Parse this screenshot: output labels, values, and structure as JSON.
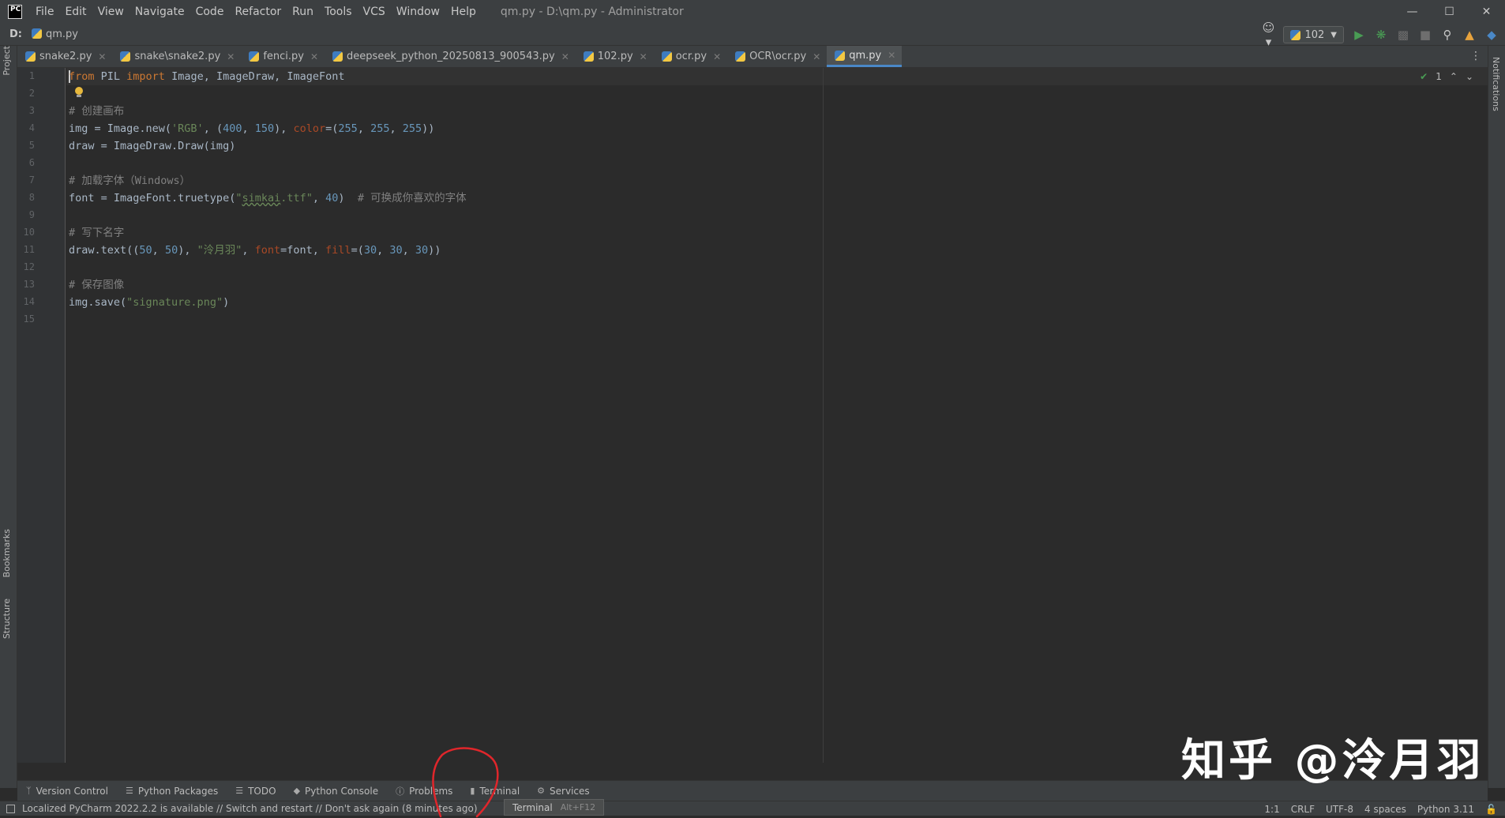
{
  "titlebar": {
    "logo": "PC",
    "menu": [
      "File",
      "Edit",
      "View",
      "Navigate",
      "Code",
      "Refactor",
      "Run",
      "Tools",
      "VCS",
      "Window",
      "Help"
    ],
    "window_title": "qm.py - D:\\qm.py - Administrator"
  },
  "navbar": {
    "drive": "D:",
    "file": "qm.py",
    "run_config": "102"
  },
  "tabs": [
    {
      "label": "snake2.py"
    },
    {
      "label": "snake\\snake2.py"
    },
    {
      "label": "fenci.py"
    },
    {
      "label": "deepseek_python_20250813_900543.py"
    },
    {
      "label": "102.py"
    },
    {
      "label": "ocr.py"
    },
    {
      "label": "OCR\\ocr.py"
    },
    {
      "label": "qm.py",
      "active": true
    }
  ],
  "left_tools": [
    "Project",
    "Bookmarks",
    "Structure"
  ],
  "right_tools": [
    "Notifications"
  ],
  "editor": {
    "line_numbers": [
      "1",
      "2",
      "3",
      "4",
      "5",
      "6",
      "7",
      "8",
      "9",
      "10",
      "11",
      "12",
      "13",
      "14",
      "15"
    ],
    "inspection_count": "1",
    "lines": {
      "l1": {
        "kw1": "from",
        "t1": " PIL ",
        "kw2": "import",
        "t2": " Image, ImageDraw, ImageFont"
      },
      "l3": "# 创建画布",
      "l4": {
        "t1": "img = Image.new(",
        "s1": "'RGB'",
        "t2": ", (",
        "n1": "400",
        "t3": ", ",
        "n2": "150",
        "t4": "), ",
        "p1": "color",
        "t5": "=(",
        "n3": "255",
        "t6": ", ",
        "n4": "255",
        "t7": ", ",
        "n5": "255",
        "t8": "))"
      },
      "l5": "draw = ImageDraw.Draw(img)",
      "l7": "# 加载字体（Windows）",
      "l8": {
        "t1": "font = ImageFont.truetype(",
        "s1a": "\"",
        "s1b": "simkai",
        "s1c": ".ttf\"",
        "t2": ", ",
        "n1": "40",
        "t3": ")  ",
        "c1": "# 可换成你喜欢的字体"
      },
      "l10": "# 写下名字",
      "l11": {
        "t1": "draw.text((",
        "n1": "50",
        "t2": ", ",
        "n2": "50",
        "t3": "), ",
        "s1": "\"泠月羽\"",
        "t4": ", ",
        "p1": "font",
        "t5": "=font, ",
        "p2": "fill",
        "t6": "=(",
        "n3": "30",
        "t7": ", ",
        "n4": "30",
        "t8": ", ",
        "n5": "30",
        "t9": "))"
      },
      "l13": "# 保存图像",
      "l14": {
        "t1": "img.save(",
        "s1": "\"signature.png\"",
        "t2": ")"
      }
    }
  },
  "bottom_tools": [
    "Version Control",
    "Python Packages",
    "TODO",
    "Python Console",
    "Problems",
    "Terminal",
    "Services"
  ],
  "status": {
    "message": "Localized PyCharm 2022.2.2 is available // Switch and restart // Don't ask again (8 minutes ago)",
    "position": "1:1",
    "line_sep": "CRLF",
    "encoding": "UTF-8",
    "indent": "4 spaces",
    "interpreter": "Python 3.11"
  },
  "tooltip": {
    "label": "Terminal",
    "shortcut": "Alt+F12"
  },
  "watermark": "知乎 @泠月羽",
  "colors": {
    "accent": "#4a88c7",
    "annotation": "#e0262b"
  }
}
